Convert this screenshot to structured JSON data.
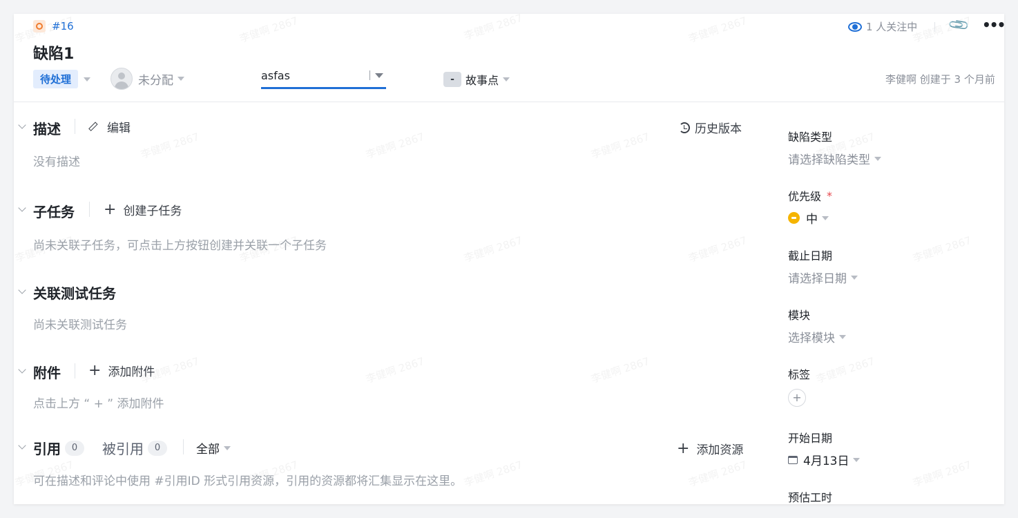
{
  "issue": {
    "id_label": "#16",
    "title": "缺陷1",
    "status": "待处理",
    "assignee": "未分配",
    "field_value": "asfas",
    "story_points_badge": "-",
    "story_points_label": "故事点",
    "followers": "1 人关注中",
    "creator_line": "李健啊 创建于 3 个月前"
  },
  "sections": {
    "description": {
      "title": "描述",
      "edit_label": "编辑",
      "history_label": "历史版本",
      "empty": "没有描述"
    },
    "subtasks": {
      "title": "子任务",
      "create_label": "创建子任务",
      "empty": "尚未关联子任务，可点击上方按钮创建并关联一个子任务"
    },
    "tests": {
      "title": "关联测试任务",
      "empty": "尚未关联测试任务"
    },
    "attachments": {
      "title": "附件",
      "add_label": "添加附件",
      "empty": "点击上方 “ + ” 添加附件"
    },
    "references": {
      "title": "引用",
      "count": "0",
      "referenced_label": "被引用",
      "referenced_count": "0",
      "filter": "全部",
      "add_label": "添加资源",
      "empty": "可在描述和评论中使用 #引用ID 形式引用资源，引用的资源都将汇集显示在这里。"
    }
  },
  "sidebar": {
    "defect_type": {
      "label": "缺陷类型",
      "value": "请选择缺陷类型"
    },
    "priority": {
      "label": "优先级",
      "required": "*",
      "value": "中"
    },
    "due_date": {
      "label": "截止日期",
      "value": "请选择日期"
    },
    "module": {
      "label": "模块",
      "value": "选择模块"
    },
    "tags": {
      "label": "标签",
      "add": "+"
    },
    "start_date": {
      "label": "开始日期",
      "value": "4月13日"
    },
    "estimate": {
      "label": "预估工时"
    }
  },
  "watermark_text": "李健啊 2867",
  "colors": {
    "accent": "#1f6fd6",
    "status_bg": "#e3edfd",
    "priority": "#f5b400",
    "issue_icon": "#f07c2e",
    "required": "#e5484d"
  }
}
